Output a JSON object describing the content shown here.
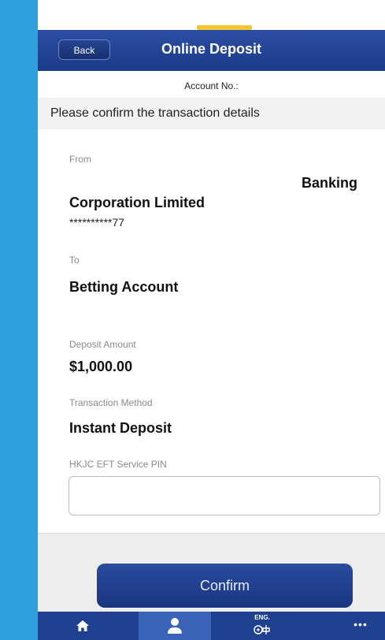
{
  "header": {
    "back_label": "Back",
    "title": "Online Deposit"
  },
  "account_no_label": "Account No.:",
  "banner_text": "Please confirm the transaction details",
  "from": {
    "label": "From",
    "bank_name": "Banking",
    "company": "Corporation Limited",
    "account_number": "**********77"
  },
  "to": {
    "label": "To",
    "value": "Betting Account"
  },
  "deposit": {
    "label": "Deposit Amount",
    "value": "$1,000.00"
  },
  "method": {
    "label": "Transaction Method",
    "value": "Instant Deposit"
  },
  "pin": {
    "label": "HKJC EFT Service PIN",
    "value": ""
  },
  "confirm_label": "Confirm",
  "tabbar": {
    "home_icon": "home-icon",
    "account_icon": "person-icon",
    "lang_label": "ENG.",
    "lang_icon": "language-toggle-icon",
    "more_icon": "more-icon",
    "more_glyph": "•••"
  },
  "colors": {
    "navbar": "#1b3a87",
    "accent": "#f4c531",
    "confirm_button": "#1a3680",
    "tabbar": "#1f3f8f",
    "side_strip": "#2f9fe0"
  }
}
